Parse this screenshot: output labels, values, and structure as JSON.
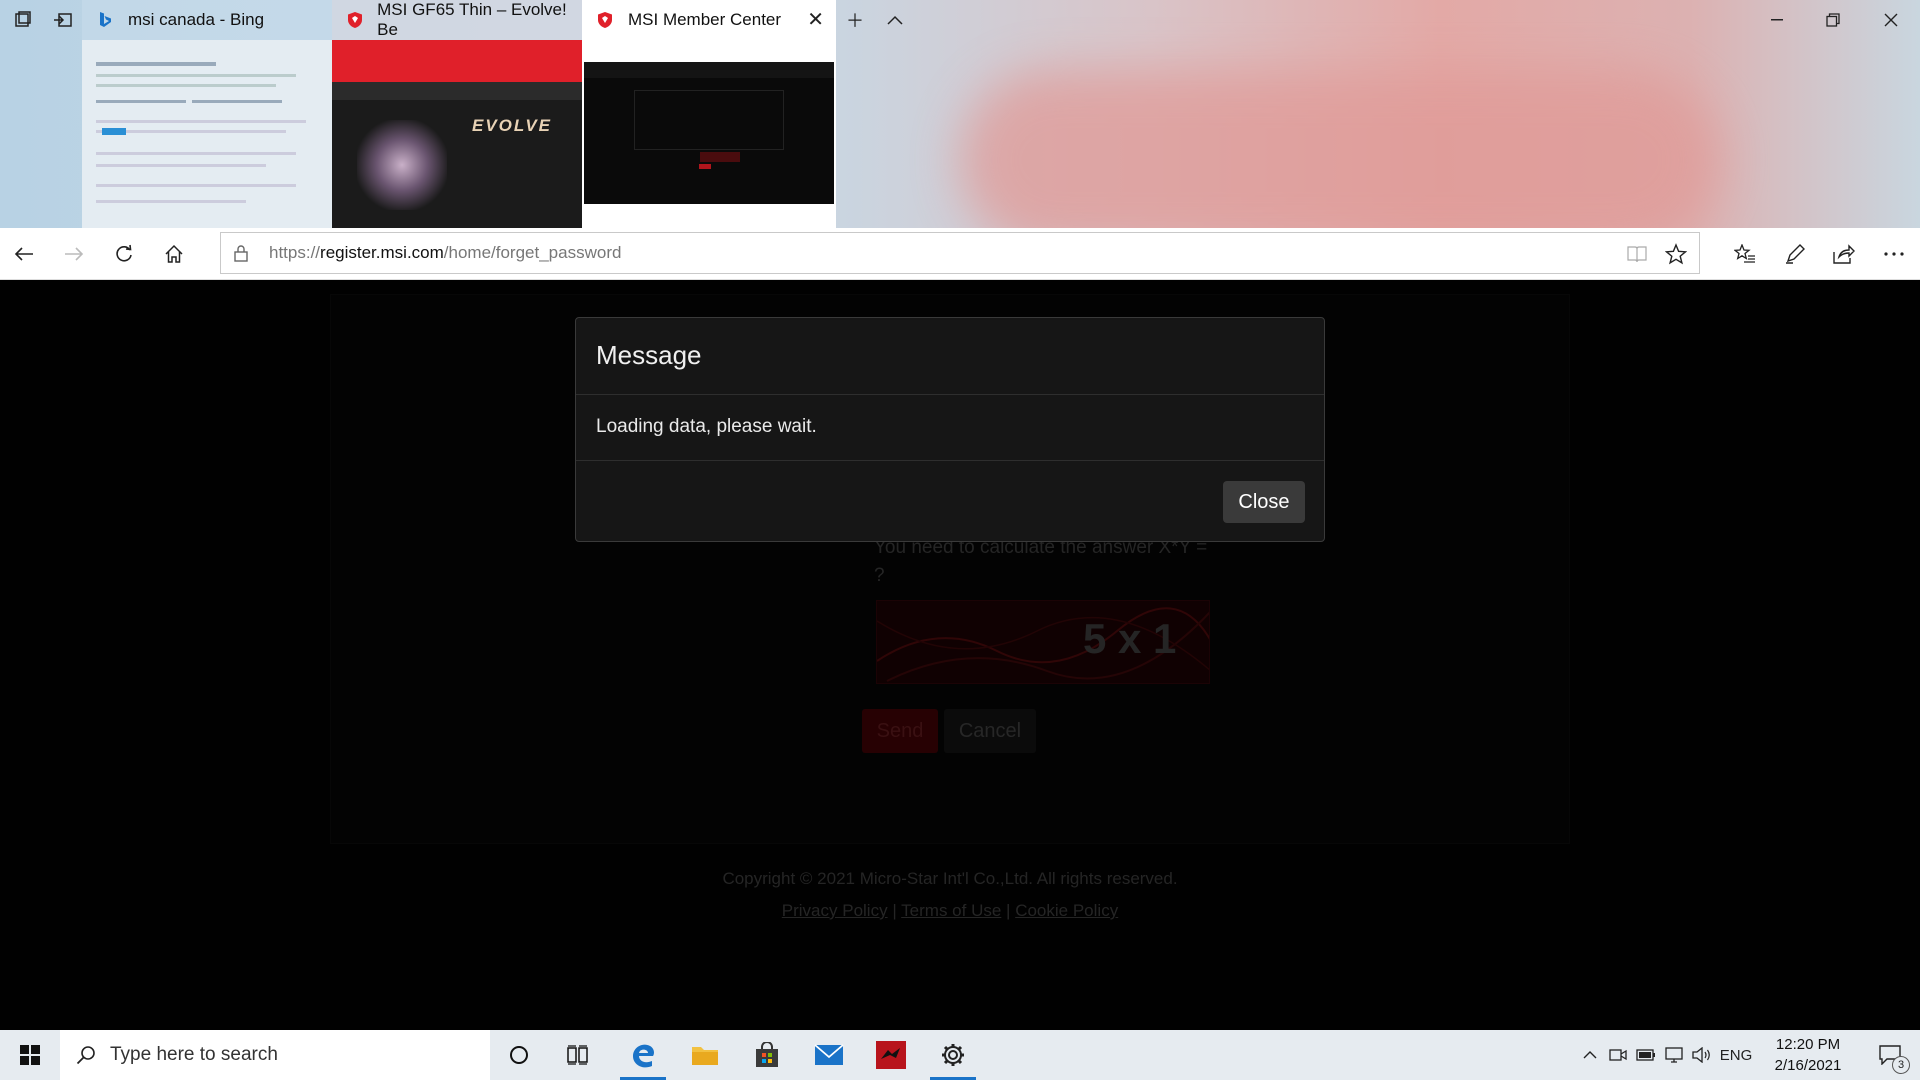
{
  "browser": {
    "tabs": [
      {
        "title": "msi canada - Bing"
      },
      {
        "title": "MSI GF65 Thin – Evolve! Be"
      },
      {
        "title": "MSI Member Center"
      }
    ],
    "url_prefix": "https://",
    "url_host": "register.msi.com",
    "url_path": "/home/forget_password"
  },
  "page": {
    "captcha_hint": "You need to calculate the answer X*Y = ?",
    "captcha_text": "5 x 1",
    "send_label": "Send",
    "cancel_label": "Cancel",
    "copyright": "Copyright © 2021 Micro-Star Int'l Co.,Ltd. All rights reserved.",
    "privacy_link": "Privacy Policy",
    "terms_link": "Terms of Use",
    "cookie_link": "Cookie Policy",
    "separator": "|"
  },
  "modal": {
    "title": "Message",
    "body": "Loading data, please wait.",
    "close_label": "Close"
  },
  "taskbar": {
    "search_placeholder": "Type here to search",
    "language": "ENG",
    "time": "12:20 PM",
    "date": "2/16/2021",
    "notifications": "3"
  },
  "colors": {
    "accent": "#1a73c8",
    "msi_red": "#e0202a",
    "modal_bg": "#161616"
  }
}
